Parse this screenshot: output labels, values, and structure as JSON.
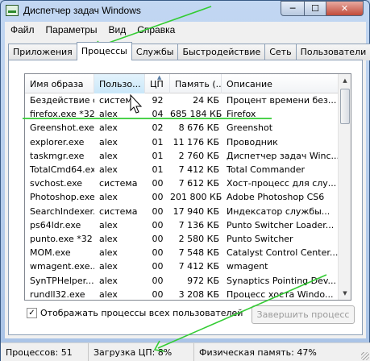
{
  "window": {
    "title": "Диспетчер задач Windows",
    "close_glyph": "✕",
    "minimize_glyph": "─",
    "maximize_glyph": "☐"
  },
  "menu": [
    "Файл",
    "Параметры",
    "Вид",
    "Справка"
  ],
  "tabs": [
    "Приложения",
    "Процессы",
    "Службы",
    "Быстродействие",
    "Сеть",
    "Пользователи"
  ],
  "active_tab": "Процессы",
  "columns": [
    "Имя образа",
    "Пользо...",
    "ЦП",
    "Память (...",
    "Описание"
  ],
  "sorted_column": "Пользо...",
  "rows": [
    {
      "name": "Бездействие с...",
      "user": "систем",
      "cpu": "92",
      "mem": "24 КБ",
      "desc": "Процент времени без..."
    },
    {
      "name": "firefox.exe *32",
      "user": "alex",
      "cpu": "04",
      "mem": "685 184 КБ",
      "desc": "Firefox"
    },
    {
      "name": "Greenshot.exe",
      "user": "alex",
      "cpu": "02",
      "mem": "8 676 КБ",
      "desc": "Greenshot"
    },
    {
      "name": "explorer.exe",
      "user": "alex",
      "cpu": "01",
      "mem": "11 176 КБ",
      "desc": "Проводник"
    },
    {
      "name": "taskmgr.exe",
      "user": "alex",
      "cpu": "01",
      "mem": "2 760 КБ",
      "desc": "Диспетчер задач Winc..."
    },
    {
      "name": "TotalCmd64.exe",
      "user": "alex",
      "cpu": "01",
      "mem": "7 412 КБ",
      "desc": "Total Commander"
    },
    {
      "name": "svchost.exe",
      "user": "система",
      "cpu": "00",
      "mem": "7 612 КБ",
      "desc": "Хост-процесс для слу..."
    },
    {
      "name": "Photoshop.exe...",
      "user": "alex",
      "cpu": "00",
      "mem": "201 800 КБ",
      "desc": "Adobe Photoshop CS6"
    },
    {
      "name": "SearchIndexer....",
      "user": "система",
      "cpu": "00",
      "mem": "17 940 КБ",
      "desc": "Индексатор службы..."
    },
    {
      "name": "ps64ldr.exe",
      "user": "alex",
      "cpu": "00",
      "mem": "7 136 КБ",
      "desc": "Punto Switcher Loader..."
    },
    {
      "name": "punto.exe *32",
      "user": "alex",
      "cpu": "00",
      "mem": "2 580 КБ",
      "desc": "Punto Switcher"
    },
    {
      "name": "MOM.exe",
      "user": "alex",
      "cpu": "00",
      "mem": "7 548 КБ",
      "desc": "Catalyst Control Center..."
    },
    {
      "name": "wmagent.exe...",
      "user": "alex",
      "cpu": "00",
      "mem": "7 412 КБ",
      "desc": "wmagent"
    },
    {
      "name": "SynTPHelper....",
      "user": "alex",
      "cpu": "00",
      "mem": "972 КБ",
      "desc": "Synaptics Pointing Dev..."
    },
    {
      "name": "rundll32.exe",
      "user": "alex",
      "cpu": "00",
      "mem": "3 208 КБ",
      "desc": "Процесс хоста Windo..."
    }
  ],
  "show_all_users": {
    "label": "Отображать процессы всех пользователей",
    "checked": true,
    "glyph": "✓"
  },
  "end_process_label": "Завершить процесс",
  "status": {
    "processes": "Процессов: 51",
    "cpu": "Загрузка ЦП: 8%",
    "memory": "Физическая память: 47%"
  },
  "colors": {
    "annotation": "#33cc33",
    "sort_header": "#c9e7f9"
  },
  "icons": {
    "sort_arrow": "▲",
    "scroll_up": "▲",
    "scroll_down": "▼",
    "cursor": "mouse-cursor-icon"
  }
}
